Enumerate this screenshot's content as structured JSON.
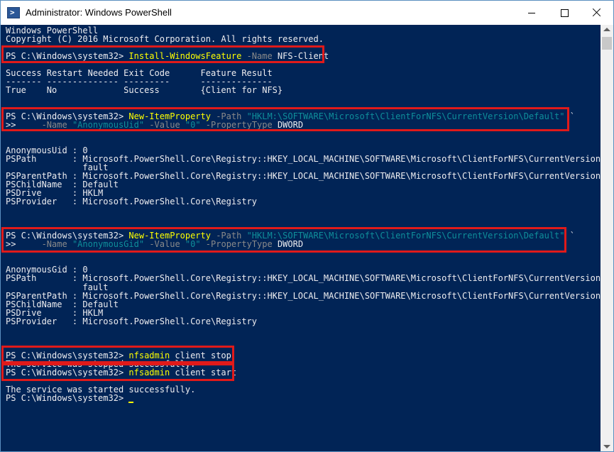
{
  "window": {
    "title": "Administrator: Windows PowerShell",
    "icon": "powershell-icon",
    "icon_glyph": ">",
    "controls": [
      "minimize-icon",
      "maximize-icon",
      "close-icon"
    ]
  },
  "colors": {
    "console_bg": "#012456",
    "text": "#eeedf0",
    "cmdlet": "#ffff00",
    "parameter": "#8a8a8a",
    "string": "#0f8e9a",
    "highlight_box": "#e01a1a"
  },
  "console": {
    "lines": [
      "Windows PowerShell",
      "Copyright (C) 2016 Microsoft Corporation. All rights reserved.",
      "",
      "PS C:\\Windows\\system32> Install-WindowsFeature -Name NFS-Client",
      "",
      "Success Restart Needed Exit Code      Feature Result",
      "------- -------------- ---------      --------------",
      "True    No             Success        {Client for NFS}",
      "",
      "",
      "PS C:\\Windows\\system32> New-ItemProperty -Path \"HKLM:\\SOFTWARE\\Microsoft\\ClientForNFS\\CurrentVersion\\Default\" `",
      ">>     -Name \"AnonymousUid\" -Value \"0\" -PropertyType DWORD",
      "",
      "",
      "AnonymousUid : 0",
      "PSPath       : Microsoft.PowerShell.Core\\Registry::HKEY_LOCAL_MACHINE\\SOFTWARE\\Microsoft\\ClientForNFS\\CurrentVersion\\De",
      "               fault",
      "PSParentPath : Microsoft.PowerShell.Core\\Registry::HKEY_LOCAL_MACHINE\\SOFTWARE\\Microsoft\\ClientForNFS\\CurrentVersion",
      "PSChildName  : Default",
      "PSDrive      : HKLM",
      "PSProvider   : Microsoft.PowerShell.Core\\Registry",
      "",
      "",
      "",
      "PS C:\\Windows\\system32> New-ItemProperty -Path \"HKLM:\\SOFTWARE\\Microsoft\\ClientForNFS\\CurrentVersion\\Default\" `",
      ">>     -Name \"AnonymousGid\" -Value \"0\" -PropertyType DWORD",
      "",
      "",
      "AnonymousGid : 0",
      "PSPath       : Microsoft.PowerShell.Core\\Registry::HKEY_LOCAL_MACHINE\\SOFTWARE\\Microsoft\\ClientForNFS\\CurrentVersion\\De",
      "               fault",
      "PSParentPath : Microsoft.PowerShell.Core\\Registry::HKEY_LOCAL_MACHINE\\SOFTWARE\\Microsoft\\ClientForNFS\\CurrentVersion",
      "PSChildName  : Default",
      "PSDrive      : HKLM",
      "PSProvider   : Microsoft.PowerShell.Core\\Registry",
      "",
      "",
      "",
      "PS C:\\Windows\\system32> nfsadmin client stop",
      "The service was stopped successfully.",
      "PS C:\\Windows\\system32> nfsadmin client start",
      "",
      "The service was started successfully.",
      "PS C:\\Windows\\system32> "
    ],
    "tokens": {
      "3": [
        [
          "PS C:\\Windows\\system32> ",
          "prompt"
        ],
        [
          "Install-WindowsFeature",
          "cmd"
        ],
        [
          " -Name ",
          "param"
        ],
        [
          "NFS-Client",
          "prompt"
        ]
      ],
      "10": [
        [
          "PS C:\\Windows\\system32> ",
          "prompt"
        ],
        [
          "New-ItemProperty",
          "cmd"
        ],
        [
          " -Path ",
          "param"
        ],
        [
          "\"HKLM:\\SOFTWARE\\Microsoft\\ClientForNFS\\CurrentVersion\\Default\"",
          "str"
        ],
        [
          " `",
          "prompt"
        ]
      ],
      "11": [
        [
          ">>     ",
          "prompt"
        ],
        [
          "-Name ",
          "param"
        ],
        [
          "\"AnonymousUid\"",
          "str"
        ],
        [
          " -Value ",
          "param"
        ],
        [
          "\"0\"",
          "str"
        ],
        [
          " -PropertyType ",
          "param"
        ],
        [
          "DWORD",
          "prompt"
        ]
      ],
      "24": [
        [
          "PS C:\\Windows\\system32> ",
          "prompt"
        ],
        [
          "New-ItemProperty",
          "cmd"
        ],
        [
          " -Path ",
          "param"
        ],
        [
          "\"HKLM:\\SOFTWARE\\Microsoft\\ClientForNFS\\CurrentVersion\\Default\"",
          "str"
        ],
        [
          " `",
          "prompt"
        ]
      ],
      "25": [
        [
          ">>     ",
          "prompt"
        ],
        [
          "-Name ",
          "param"
        ],
        [
          "\"AnonymousGid\"",
          "str"
        ],
        [
          " -Value ",
          "param"
        ],
        [
          "\"0\"",
          "str"
        ],
        [
          " -PropertyType ",
          "param"
        ],
        [
          "DWORD",
          "prompt"
        ]
      ],
      "38": [
        [
          "PS C:\\Windows\\system32> ",
          "prompt"
        ],
        [
          "nfsadmin",
          "cmd"
        ],
        [
          " client stop",
          "prompt"
        ]
      ],
      "40": [
        [
          "PS C:\\Windows\\system32> ",
          "prompt"
        ],
        [
          "nfsadmin",
          "cmd"
        ],
        [
          " client start",
          "prompt"
        ]
      ]
    },
    "highlighted_commands": [
      "Install-WindowsFeature -Name NFS-Client",
      "New-ItemProperty AnonymousUid",
      "New-ItemProperty AnonymousGid",
      "nfsadmin client stop",
      "nfsadmin client start"
    ]
  }
}
